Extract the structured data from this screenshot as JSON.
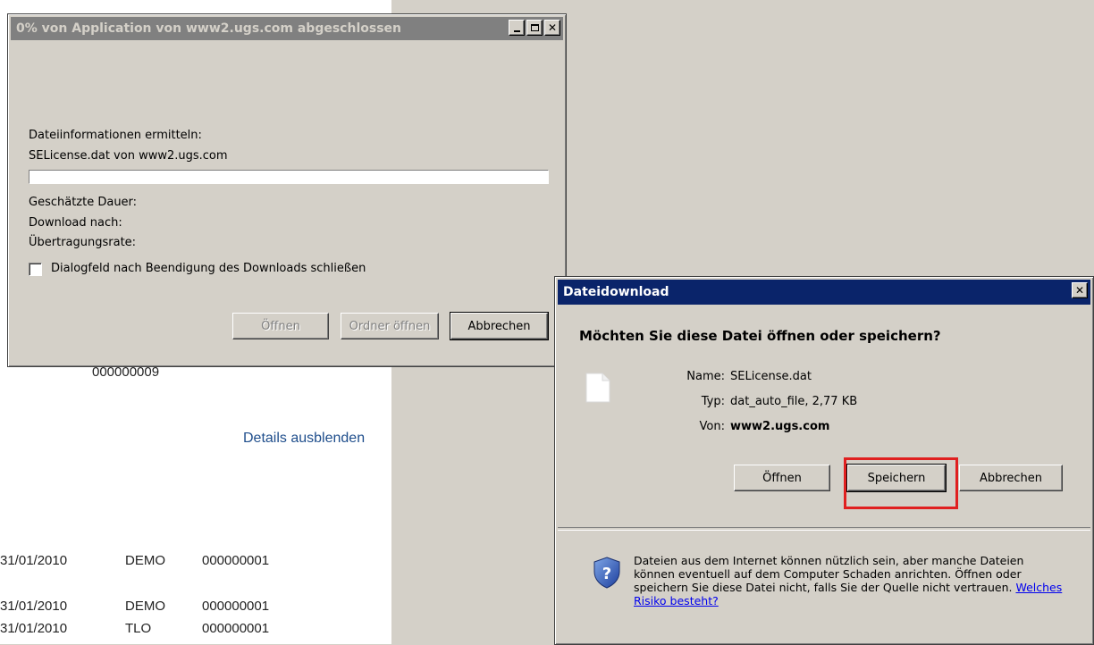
{
  "background": {
    "partial_number": "000000009",
    "details_link": "Details ausblenden",
    "rows": [
      {
        "date": "31/01/2010",
        "type": "DEMO",
        "number": "000000001"
      },
      {
        "date": "31/01/2010",
        "type": "DEMO",
        "number": "000000001"
      },
      {
        "date": "31/01/2010",
        "type": "TLO",
        "number": "000000001"
      }
    ]
  },
  "progress_dialog": {
    "title": "0% von Application von www2.ugs.com abgeschlossen",
    "status": "Dateiinformationen ermitteln:",
    "source": "SELicense.dat von www2.ugs.com",
    "progress_percent": 0,
    "estimated_label": "Geschätzte Dauer:",
    "download_to_label": "Download nach:",
    "rate_label": "Übertragungsrate:",
    "close_checkbox_label": "Dialogfeld nach Beendigung des Downloads schließen",
    "close_checkbox_checked": false,
    "buttons": {
      "open": "Öffnen",
      "open_folder": "Ordner öffnen",
      "cancel": "Abbrechen"
    }
  },
  "download_dialog": {
    "title": "Dateidownload",
    "question": "Möchten Sie diese Datei öffnen oder speichern?",
    "name_label": "Name:",
    "name_value": "SELicense.dat",
    "type_label": "Typ:",
    "type_value": "dat_auto_file, 2,77 KB",
    "from_label": "Von:",
    "from_value": "www2.ugs.com",
    "buttons": {
      "open": "Öffnen",
      "save": "Speichern",
      "cancel": "Abbrechen"
    },
    "warning_text": "Dateien aus dem Internet können nützlich sein, aber manche Dateien können eventuell auf dem Computer Schaden anrichten. Öffnen oder speichern Sie diese Datei nicht, falls Sie der Quelle nicht vertrauen.",
    "risk_link": "Welches Risiko besteht?"
  },
  "icons": {
    "file": "file-icon",
    "shield": "shield-question-icon"
  }
}
